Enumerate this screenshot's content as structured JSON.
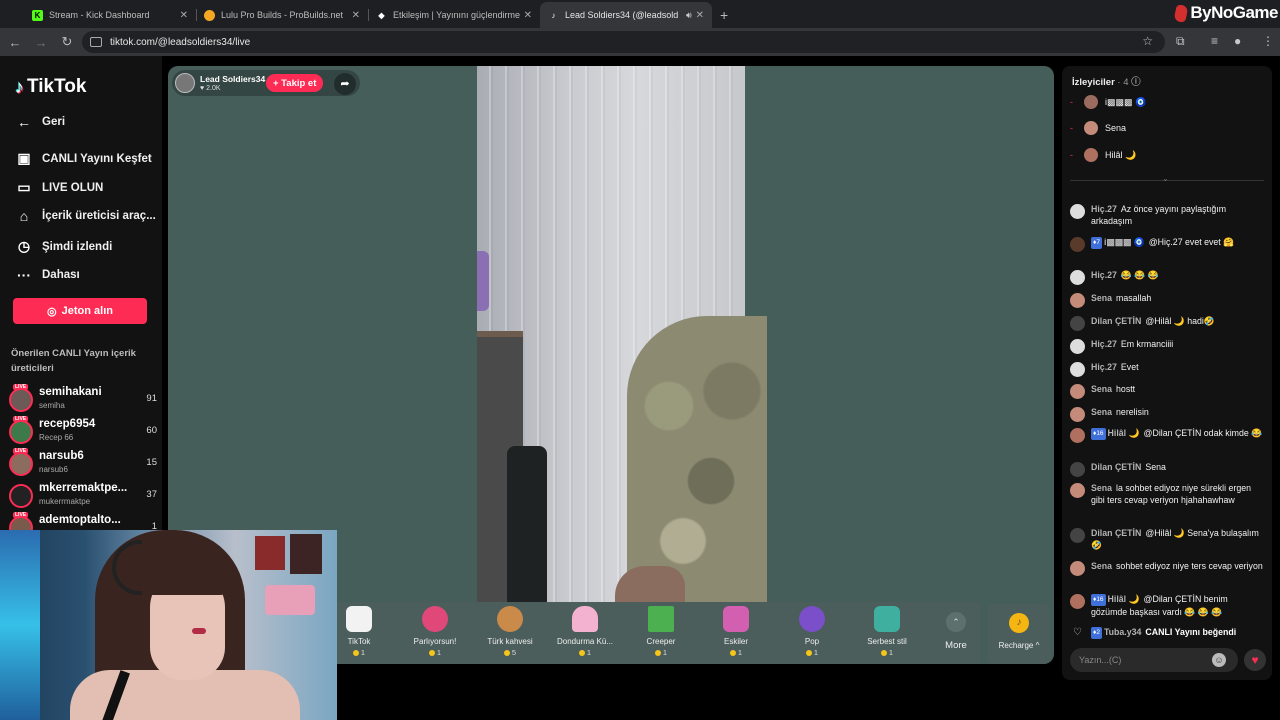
{
  "browser": {
    "tabs": [
      {
        "title": "Stream - Kick Dashboard",
        "icon": "kick-icon",
        "color": "#53fc18"
      },
      {
        "title": "Lulu Pro Builds - ProBuilds.net",
        "icon": "probuilds-icon",
        "color": "#f5a623"
      },
      {
        "title": "Etkileşim | Yayınını güçlendirme",
        "icon": "diamond-icon",
        "color": "#ffffff"
      },
      {
        "title": "Lead Soldiers34 (@leadsold",
        "icon": "tiktok-icon",
        "color": "#ffffff"
      }
    ],
    "new_tab": "+",
    "url": "tiktok.com/@leadsoldiers34/live",
    "watermark": "ByNoGame"
  },
  "sidebar": {
    "logo": "TikTok",
    "back": "Geri",
    "nav": [
      "CANLI Yayını Keşfet",
      "LIVE OLUN",
      "İçerik üreticisi araç...",
      "Şimdi izlendi",
      "Dahası"
    ],
    "coins_button": "Jeton alın",
    "suggested_title": "Önerilen CANLI Yayın içerik üreticileri",
    "live_badge": "LIVE",
    "creators": [
      {
        "name": "semihakani",
        "sub": "semiha",
        "count": "91"
      },
      {
        "name": "recep6954",
        "sub": "Recep 66",
        "count": "60"
      },
      {
        "name": "narsub6",
        "sub": "narsub6",
        "count": "15"
      },
      {
        "name": "mkerremaktpe...",
        "sub": "mukerrmaktpe",
        "count": "37"
      },
      {
        "name": "ademtoptalto...",
        "sub": "",
        "count": "1"
      }
    ]
  },
  "stream": {
    "host": "Lead Soldiers34",
    "likes": "♥ 2.0K",
    "follow": "+ Takip et"
  },
  "gifts": [
    {
      "name": "TikTok",
      "price": "1",
      "color": "#f2f2f2"
    },
    {
      "name": "Parlıyorsun!",
      "price": "1",
      "color": "#e0487a"
    },
    {
      "name": "Türk kahvesi",
      "price": "5",
      "color": "#c98a4a"
    },
    {
      "name": "Dondurma Kü...",
      "price": "1",
      "color": "#f3b3d0"
    },
    {
      "name": "Creeper",
      "price": "1",
      "color": "#4caf50"
    },
    {
      "name": "Eskiler",
      "price": "1",
      "color": "#d35fb0"
    },
    {
      "name": "Pop",
      "price": "1",
      "color": "#7a4fc9"
    },
    {
      "name": "Serbest stil",
      "price": "1",
      "color": "#3fb0a0"
    }
  ],
  "more": "More",
  "recharge": "Recharge ^",
  "viewers": {
    "title": "İzleyiciler",
    "count": "· 4",
    "list": [
      {
        "name": "i▩▩▩ 🧿"
      },
      {
        "name": "Sena"
      },
      {
        "name": "Hilâl 🌙"
      }
    ]
  },
  "chat": [
    {
      "user": "Hiç.27",
      "badge": "",
      "text": "Az önce yayını paylaştığım arkadaşım"
    },
    {
      "user": "i▩▩▩ 🧿",
      "badge": "7",
      "text": "@Hiç.27 evet evet 🤗"
    },
    {
      "user": "Hiç.27",
      "badge": "",
      "text": "😂 😂 😂"
    },
    {
      "user": "Sena",
      "badge": "",
      "text": "masallah"
    },
    {
      "user": "Dilan ÇETİN",
      "badge": "",
      "text": "@Hilâl 🌙 hadi🤣"
    },
    {
      "user": "Hiç.27",
      "badge": "",
      "text": "Em krmanciiii"
    },
    {
      "user": "Hiç.27",
      "badge": "",
      "text": "Evet"
    },
    {
      "user": "Sena",
      "badge": "",
      "text": "hostt"
    },
    {
      "user": "Sena",
      "badge": "",
      "text": "nerelisin"
    },
    {
      "user": "Hilâl 🌙",
      "badge": "16",
      "text": "@Dilan ÇETİN odak kimde 😂"
    },
    {
      "user": "Dilan ÇETİN",
      "badge": "",
      "text": "Sena"
    },
    {
      "user": "Sena",
      "badge": "",
      "text": "la sohbet ediyoz niye sürekli ergen gibi ters cevap veriyon hjahahawhaw"
    },
    {
      "user": "Dilan ÇETİN",
      "badge": "",
      "text": "@Hilâl 🌙 Sena'ya bulaşalım🤣"
    },
    {
      "user": "Sena",
      "badge": "",
      "text": "sohbet ediyoz niye ters cevap veriyon"
    },
    {
      "user": "Hilâl 🌙",
      "badge": "16",
      "text": "@Dilan ÇETİN benim gözümde başkası vardı 😂 😂 😂"
    },
    {
      "user": "Tuba.y34",
      "badge": "2",
      "text": "CANLI Yayını beğendi"
    }
  ],
  "chat_input_placeholder": "Yazın...(C)"
}
